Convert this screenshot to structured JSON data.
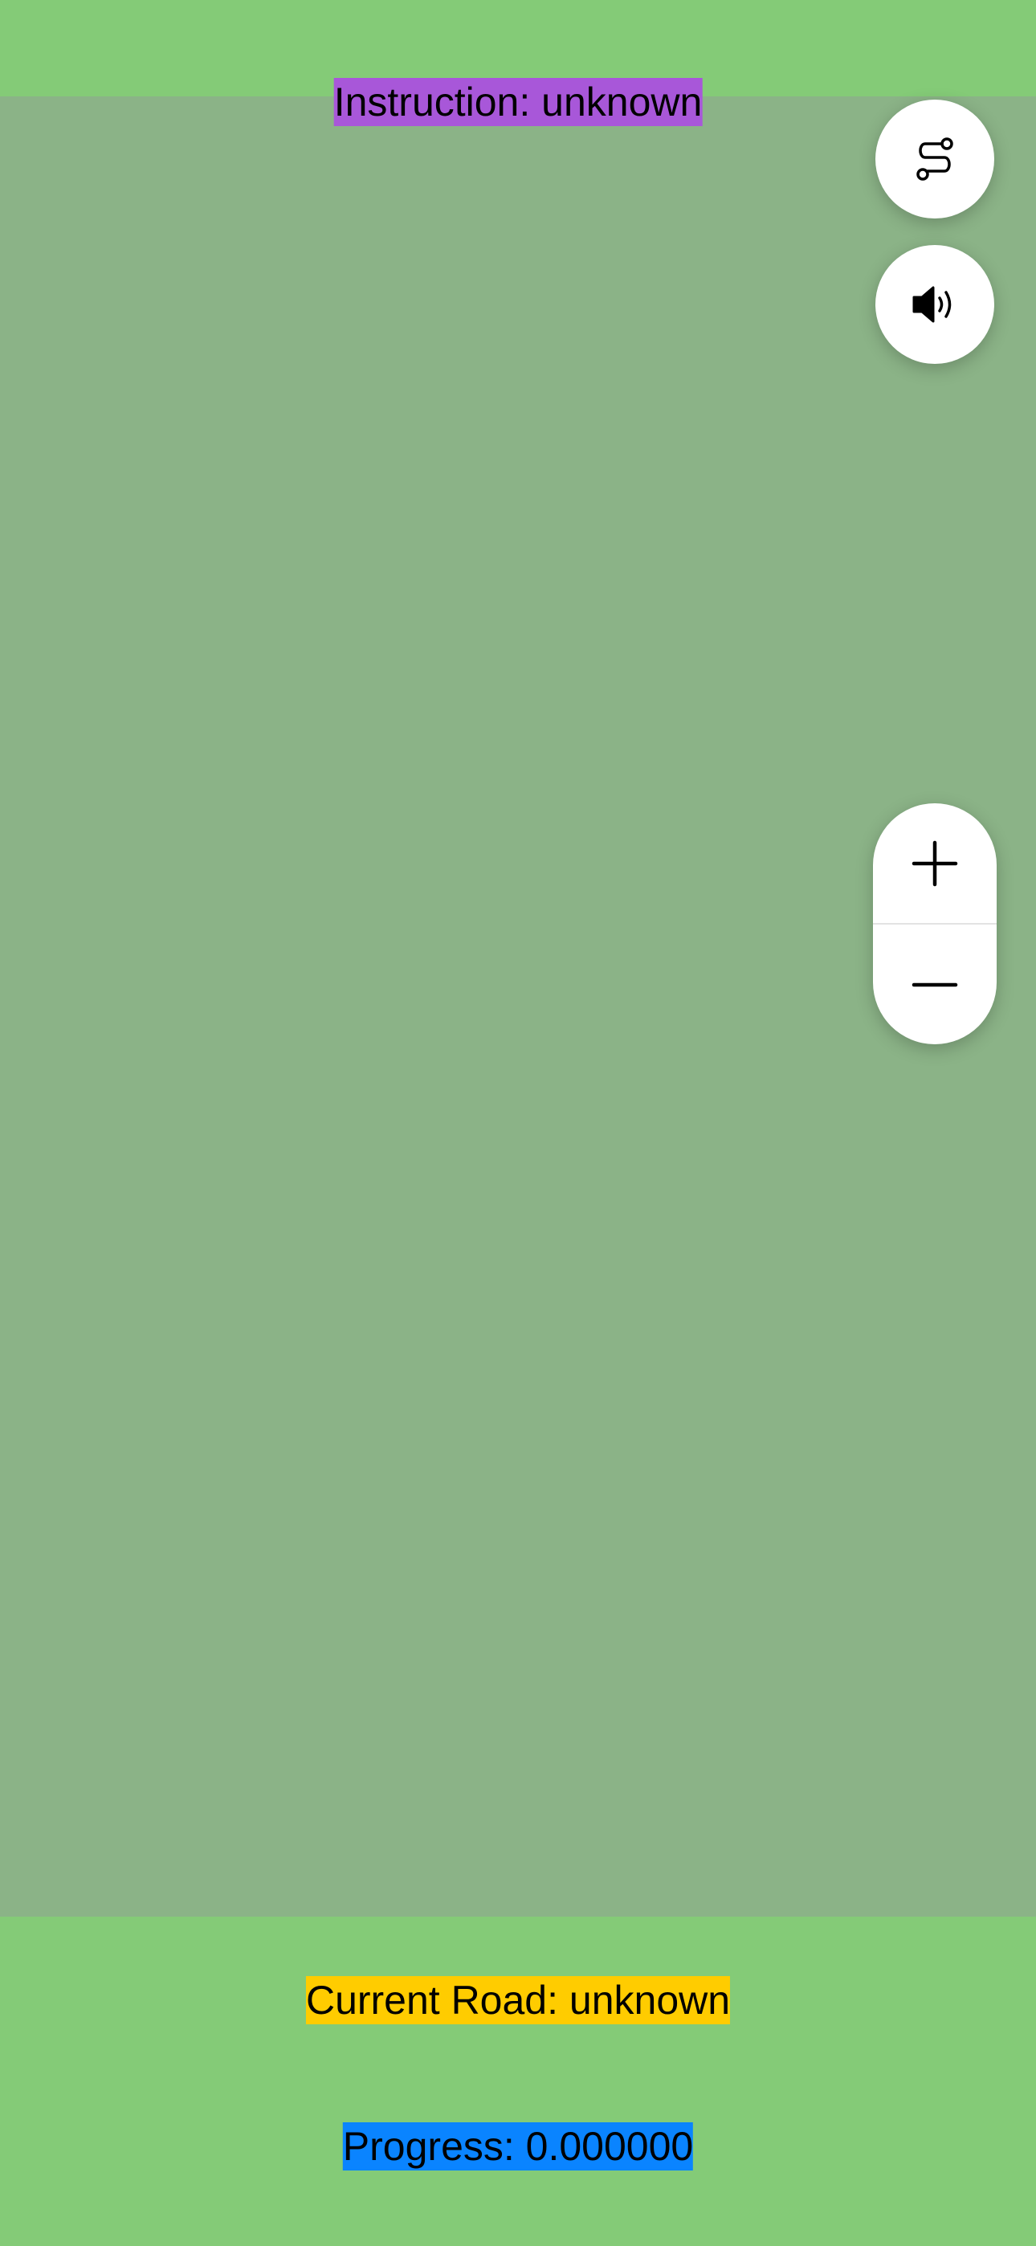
{
  "instruction": {
    "text": "Instruction: unknown",
    "background": "#a857d9"
  },
  "controls": {
    "route_overview": {
      "icon": "route-icon"
    },
    "mute": {
      "icon": "speaker-icon"
    },
    "zoom_in": {
      "icon": "plus-icon"
    },
    "zoom_out": {
      "icon": "minus-icon"
    }
  },
  "footer": {
    "current_road": "Current Road: unknown",
    "current_road_background": "#ffcc00",
    "progress": "Progress: 0.000000",
    "progress_background": "#0a84ff"
  },
  "colors": {
    "background": "#84cb77",
    "map": "#8bb387",
    "button": "#ffffff"
  }
}
